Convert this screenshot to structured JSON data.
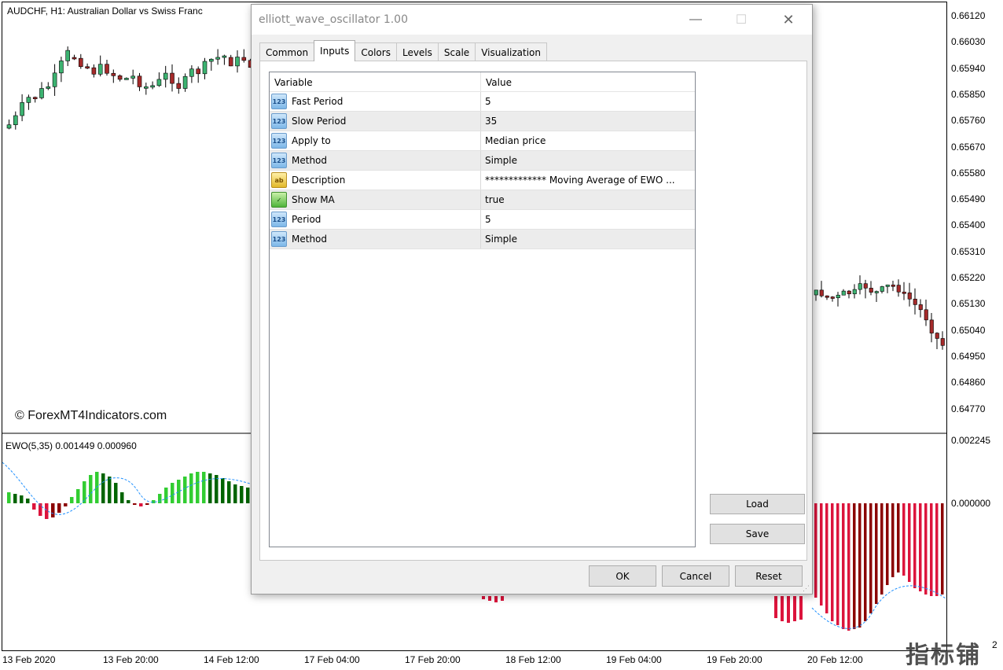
{
  "chart": {
    "title": "AUDCHF, H1:  Australian Dollar vs Swiss Franc",
    "watermark": "© ForexMT4Indicators.com",
    "indicator_label": "EWO(5,35) 0.001449 0.000960",
    "price_labels": [
      "0.66120",
      "0.66030",
      "0.65940",
      "0.65850",
      "0.65760",
      "0.65670",
      "0.65580",
      "0.65490",
      "0.65400",
      "0.65310",
      "0.65220",
      "0.65130",
      "0.65040",
      "0.64950",
      "0.64860",
      "0.64770"
    ],
    "indicator_scale": [
      "0.002245",
      "0.000000",
      "2"
    ],
    "time_labels": [
      "13 Feb 2020",
      "13 Feb 20:00",
      "14 Feb 12:00",
      "17 Feb 04:00",
      "17 Feb 20:00",
      "18 Feb 12:00",
      "19 Feb 04:00",
      "19 Feb 20:00",
      "20 Feb 12:00"
    ],
    "logo_text": "指标铺",
    "colors": {
      "bull": "#3cb371",
      "bear": "#a52a2a",
      "ewo_up": "#32cd32",
      "ewo_up_dark": "#006400",
      "ewo_down": "#dc143c",
      "ewo_down_dark": "#8b0000",
      "ma_line": "#1e90ff"
    }
  },
  "dialog": {
    "title": "elliott_wave_oscillator 1.00",
    "controls": {
      "minimize": "—",
      "maximize": "☐",
      "close": "✕"
    },
    "tabs": [
      {
        "label": "Common",
        "active": false
      },
      {
        "label": "Inputs",
        "active": true
      },
      {
        "label": "Colors",
        "active": false
      },
      {
        "label": "Levels",
        "active": false
      },
      {
        "label": "Scale",
        "active": false
      },
      {
        "label": "Visualization",
        "active": false
      }
    ],
    "grid": {
      "col_variable": "Variable",
      "col_value": "Value",
      "rows": [
        {
          "icon": "123",
          "type": "num",
          "variable": "Fast Period",
          "value": "5"
        },
        {
          "icon": "123",
          "type": "num",
          "variable": "Slow Period",
          "value": "35"
        },
        {
          "icon": "123",
          "type": "num",
          "variable": "Apply to",
          "value": "Median price"
        },
        {
          "icon": "123",
          "type": "num",
          "variable": "Method",
          "value": "Simple"
        },
        {
          "icon": "ab",
          "type": "str",
          "variable": "Description",
          "value": "************* Moving Average of EWO ..."
        },
        {
          "icon": "✓",
          "type": "bool",
          "variable": "Show MA",
          "value": "true"
        },
        {
          "icon": "123",
          "type": "num",
          "variable": "Period",
          "value": "5"
        },
        {
          "icon": "123",
          "type": "num",
          "variable": "Method",
          "value": "Simple"
        }
      ]
    },
    "buttons": {
      "load": "Load",
      "save": "Save",
      "ok": "OK",
      "cancel": "Cancel",
      "reset": "Reset"
    }
  }
}
